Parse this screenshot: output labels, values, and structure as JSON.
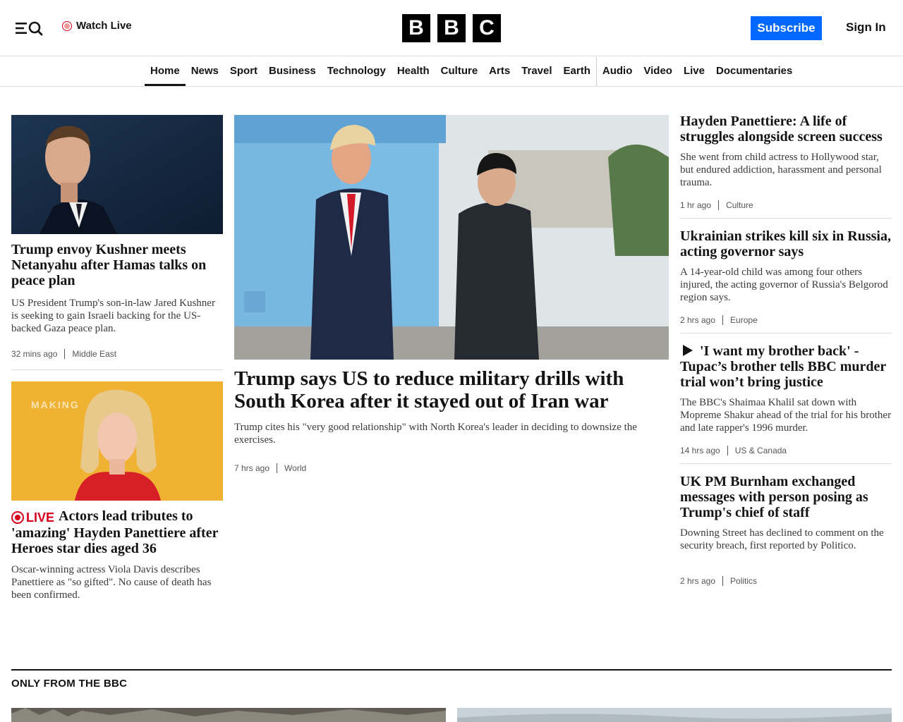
{
  "header": {
    "watch_live": "Watch Live",
    "logo_letters": [
      "B",
      "B",
      "C"
    ],
    "subscribe": "Subscribe",
    "sign_in": "Sign In"
  },
  "nav": {
    "items": [
      "Home",
      "News",
      "Sport",
      "Business",
      "Technology",
      "Health",
      "Culture",
      "Arts",
      "Travel",
      "Earth",
      "Audio",
      "Video",
      "Live",
      "Documentaries"
    ],
    "active": "Home"
  },
  "stories": {
    "kushner": {
      "headline": "Trump envoy Kushner meets Netanyahu after Hamas talks on peace plan",
      "summary": "US President Trump's son-in-law Jared Kushner is seeking to gain Israeli backing for the US-backed Gaza peace plan.",
      "time": "32 mins ago",
      "tag": "Middle East"
    },
    "panettiere_live": {
      "live_label": "LIVE",
      "headline": "Actors lead tributes to 'amazing' Hayden Panettiere after Heroes star dies aged 36",
      "summary": "Oscar-winning actress Viola Davis describes Panettiere as \"so gifted\". No cause of death has been confirmed.",
      "image_text": "MAKING"
    },
    "main": {
      "headline": "Trump says US to reduce military drills with South Korea after it stayed out of Iran war",
      "summary": "Trump cites his \"very good relationship\" with North Korea's leader in deciding to downsize the exercises.",
      "time": "7 hrs ago",
      "tag": "World"
    },
    "right": [
      {
        "headline": "Hayden Panettiere: A life of struggles alongside screen success",
        "summary": "She went from child actress to Hollywood star, but endured addiction, harassment and personal trauma.",
        "time": "1 hr ago",
        "tag": "Culture"
      },
      {
        "headline": "Ukrainian strikes kill six in Russia, acting governor says",
        "summary": "A 14-year-old child was among four others injured, the acting governor of Russia's Belgorod region says.",
        "time": "2 hrs ago",
        "tag": "Europe"
      },
      {
        "headline": "'I want my brother back' - Tupac’s brother tells BBC murder trial won’t bring justice",
        "summary": "The BBC's Shaimaa Khalil sat down with Mopreme Shakur ahead of the trial for his brother and late rapper's 1996 murder.",
        "time": "14 hrs ago",
        "tag": "US & Canada"
      },
      {
        "headline": "UK PM Burnham exchanged messages with person posing as Trump's chief of staff",
        "summary": "Downing Street has declined to comment on the security breach, first reported by Politico.",
        "time": "2 hrs ago",
        "tag": "Politics"
      }
    ]
  },
  "section": {
    "title": "ONLY FROM THE BBC"
  },
  "colors": {
    "subscribe_blue": "#0068ff",
    "live_red": "#d6001c",
    "text": "#141414"
  }
}
